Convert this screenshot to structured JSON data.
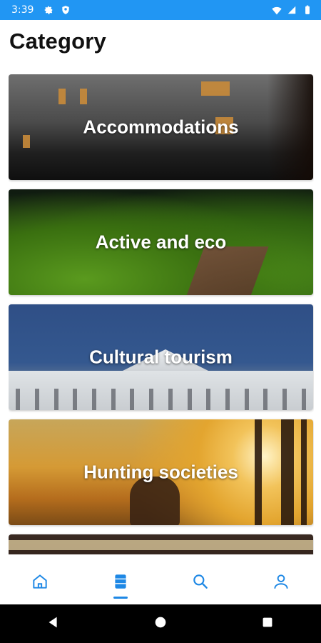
{
  "status_bar": {
    "time": "3:39",
    "icons_left": [
      "gear-icon",
      "shield-icon"
    ],
    "icons_right": [
      "wifi-icon",
      "signal-icon",
      "battery-icon"
    ],
    "color": "#2196f3"
  },
  "page": {
    "title": "Category"
  },
  "categories": [
    {
      "label": "Accommodations"
    },
    {
      "label": "Active and eco"
    },
    {
      "label": "Cultural tourism"
    },
    {
      "label": "Hunting societies"
    },
    {
      "label": ""
    }
  ],
  "bottom_nav": {
    "items": [
      {
        "icon": "home-icon"
      },
      {
        "icon": "category-icon",
        "active": true
      },
      {
        "icon": "search-icon"
      },
      {
        "icon": "profile-icon"
      }
    ],
    "accent": "#1e88e5"
  },
  "system_nav": {
    "items": [
      "back-icon",
      "home-circle-icon",
      "recents-icon"
    ]
  }
}
